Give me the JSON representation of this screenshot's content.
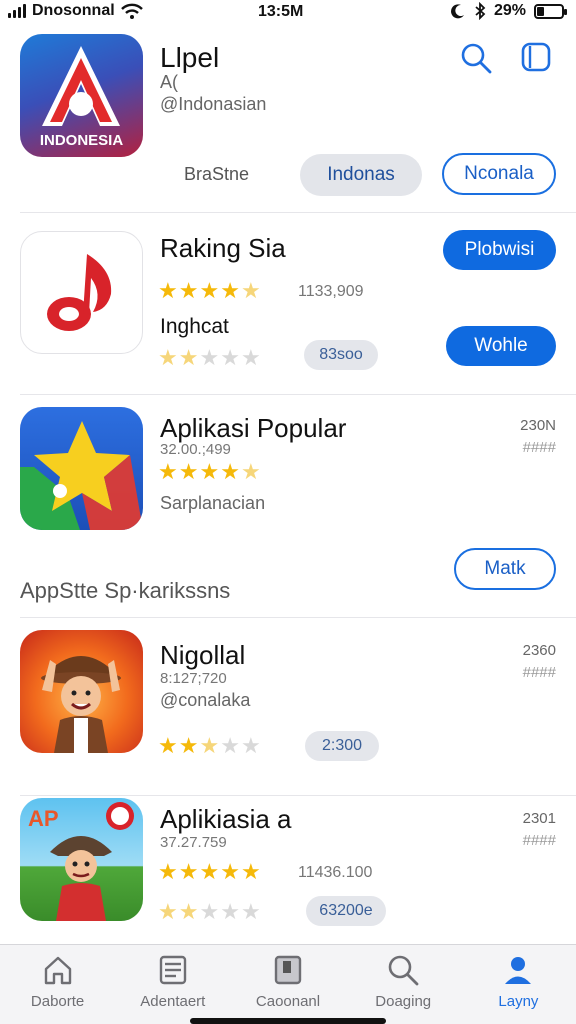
{
  "status_bar": {
    "carrier": "Dnosonnal",
    "time": "13:5M",
    "battery": "29%",
    "battery_level": 0.29
  },
  "featured": {
    "title": "Llpel",
    "line2": "A(",
    "developer": "@Indonasian",
    "icon_text": "INDONESIA",
    "option_text": "BraStne",
    "chip_gray": "Indonas",
    "chip_outline": "Nconala"
  },
  "header_icons": {
    "search": "search-icon",
    "window": "window-icon"
  },
  "apps": [
    {
      "name": "Raking Sia",
      "subtitle": "Inghcat",
      "count": "1133,909",
      "rating": 4.5,
      "rating2": 2,
      "pill": "83soo",
      "button1": "Plobwisi",
      "button2": "Wohle"
    },
    {
      "name": "Aplikasi Popular",
      "line2": "32.00.;499",
      "category": "Sarplanacian",
      "rating": 4.5,
      "meta_top": "230N",
      "meta_bottom": "####",
      "button": "Matk"
    },
    {
      "name": "Nigollal",
      "line2": "8:127;720",
      "developer": "@conalaka",
      "rating": 2.5,
      "meta_top": "2360",
      "meta_bottom": "####",
      "pill": "2:300"
    },
    {
      "name": "Aplikiasia a",
      "line2": "37.27.759",
      "count": "11436.100",
      "rating": 5,
      "rating2": 2,
      "meta_top": "2301",
      "meta_bottom": "####",
      "pill": "63200e"
    }
  ],
  "section_label": "AppStte Sp·karikssns",
  "tabs": [
    {
      "label": "Daborte",
      "icon": "home-icon"
    },
    {
      "label": "Adentaert",
      "icon": "apps-icon"
    },
    {
      "label": "Caoonanl",
      "icon": "book-icon"
    },
    {
      "label": "Doaging",
      "icon": "search-icon"
    },
    {
      "label": "Layny",
      "icon": "person-icon"
    }
  ],
  "colors": {
    "accent": "#0f6ae0",
    "star": "#f5b90a",
    "divider": "#e6e6ea"
  }
}
